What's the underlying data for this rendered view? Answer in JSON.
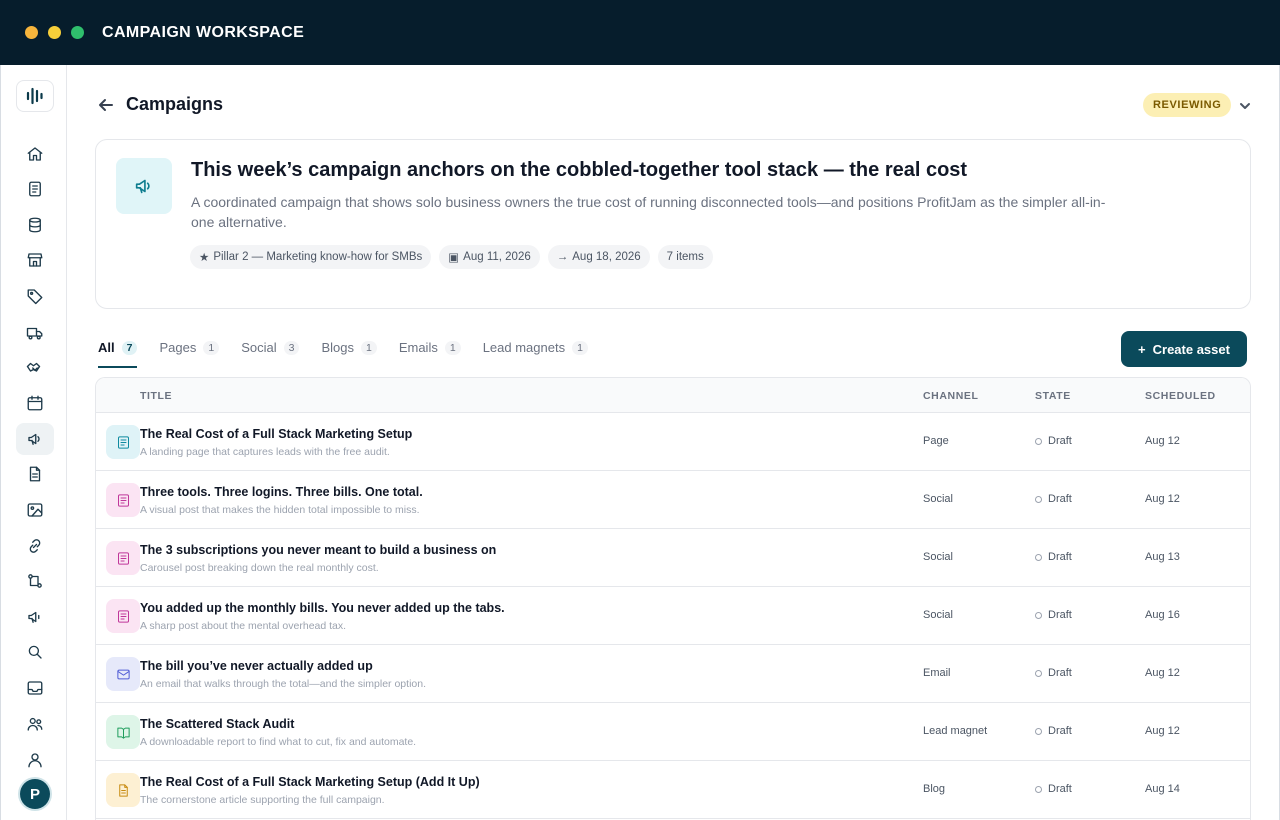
{
  "window": {
    "title": "CAMPAIGN WORKSPACE",
    "dot_colors": [
      "#f6b53c",
      "#f6cf3a",
      "#2fbf6d"
    ]
  },
  "sidebar": {
    "logo_icon": "soundwave-logo-icon",
    "items": [
      {
        "icon": "home-icon"
      },
      {
        "icon": "document-icon"
      },
      {
        "icon": "database-icon"
      },
      {
        "icon": "store-icon"
      },
      {
        "icon": "tag-icon"
      },
      {
        "icon": "truck-icon"
      },
      {
        "icon": "handshake-icon"
      },
      {
        "icon": "calendar-icon"
      },
      {
        "icon": "megaphone-icon",
        "active": true
      },
      {
        "icon": "file-icon"
      },
      {
        "icon": "image-icon"
      },
      {
        "icon": "link-icon"
      },
      {
        "icon": "workflow-icon"
      },
      {
        "icon": "broadcast-icon"
      },
      {
        "icon": "search-icon"
      },
      {
        "icon": "inbox-icon"
      },
      {
        "icon": "users-icon"
      },
      {
        "icon": "user-icon"
      }
    ],
    "avatar_initial": "P"
  },
  "header": {
    "title": "Campaigns",
    "status": "REVIEWING"
  },
  "campaign": {
    "title": "This week’s campaign anchors on the cobbled-together tool stack — the real cost",
    "description": "A coordinated campaign that shows solo business owners the true cost of running disconnected tools—and positions ProfitJam as the simpler all-in-one alternative.",
    "chips": [
      {
        "glyph": "★",
        "text": "Pillar 2 — Marketing know-how for SMBs"
      },
      {
        "glyph": "▣",
        "text": "Aug 11, 2026"
      },
      {
        "glyph": "→",
        "text": "Aug 18, 2026"
      },
      {
        "glyph": "",
        "text": "7 items"
      }
    ]
  },
  "tabs": [
    {
      "label": "All",
      "count": "7",
      "active": true
    },
    {
      "label": "Pages",
      "count": "1"
    },
    {
      "label": "Social",
      "count": "3"
    },
    {
      "label": "Blogs",
      "count": "1"
    },
    {
      "label": "Emails",
      "count": "1"
    },
    {
      "label": "Lead magnets",
      "count": "1"
    }
  ],
  "create_button": {
    "plus": "+",
    "label": "Create asset"
  },
  "table": {
    "columns": {
      "title": "TITLE",
      "channel": "CHANNEL",
      "state": "STATE",
      "scheduled": "SCHEDULED"
    },
    "rows": [
      {
        "title": "The Real Cost of a Full Stack Marketing Setup",
        "subtitle": "A landing page that captures leads with the free audit.",
        "channel": "Page",
        "state": "Draft",
        "scheduled": "Aug 12",
        "icon": "page-icon",
        "icon_bg": "#dff3f7",
        "icon_color": "#0e8aa0"
      },
      {
        "title": "Three tools. Three logins. Three bills. One total.",
        "subtitle": "A visual post that makes the hidden total impossible to miss.",
        "channel": "Social",
        "state": "Draft",
        "scheduled": "Aug 12",
        "icon": "social-post-icon",
        "icon_bg": "#fbe4f3",
        "icon_color": "#c0379a"
      },
      {
        "title": "The 3 subscriptions you never meant to build a business on",
        "subtitle": "Carousel post breaking down the real monthly cost.",
        "channel": "Social",
        "state": "Draft",
        "scheduled": "Aug 13",
        "icon": "social-post-icon",
        "icon_bg": "#fbe4f3",
        "icon_color": "#c0379a"
      },
      {
        "title": "You added up the monthly bills. You never added up the tabs.",
        "subtitle": "A sharp post about the mental overhead tax.",
        "channel": "Social",
        "state": "Draft",
        "scheduled": "Aug 16",
        "icon": "social-post-icon",
        "icon_bg": "#fbe4f3",
        "icon_color": "#c0379a"
      },
      {
        "title": "The bill you’ve never actually added up",
        "subtitle": "An email that walks through the total—and the simpler option.",
        "channel": "Email",
        "state": "Draft",
        "scheduled": "Aug 12",
        "icon": "mail-icon",
        "icon_bg": "#e6e9fa",
        "icon_color": "#4f5bd5"
      },
      {
        "title": "The Scattered Stack Audit",
        "subtitle": "A downloadable report to find what to cut, fix and automate.",
        "channel": "Lead magnet",
        "state": "Draft",
        "scheduled": "Aug 12",
        "icon": "book-open-icon",
        "icon_bg": "#def5e8",
        "icon_color": "#1f9d5c"
      },
      {
        "title": "The Real Cost of a Full Stack Marketing Setup (Add It Up)",
        "subtitle": "The cornerstone article supporting the full campaign.",
        "channel": "Blog",
        "state": "Draft",
        "scheduled": "Aug 14",
        "icon": "blog-icon",
        "icon_bg": "#fdf0d3",
        "icon_color": "#c78a10"
      }
    ]
  }
}
